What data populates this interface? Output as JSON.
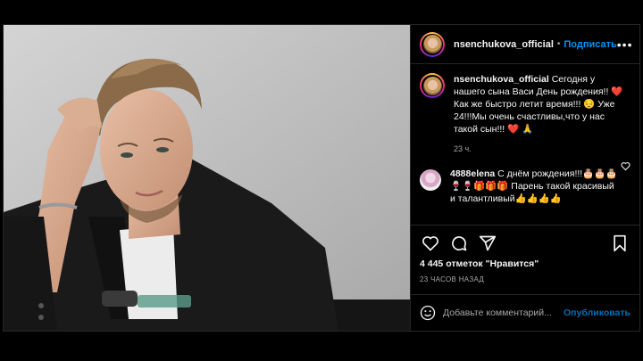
{
  "post": {
    "username": "nsenchukova_official",
    "follow_label": "Подписать",
    "more_label": "•••",
    "separator": "•"
  },
  "caption": {
    "username": "nsenchukova_official",
    "text": " Сегодня у нашего сына Васи День рождения!! ❤️ Как же быстро летит время!!! 😔 Уже 24!!!Мы очень счастливы,что у нас такой сын!!! ❤️ 🙏",
    "time": "23 ч."
  },
  "comment": {
    "username": "4888elena",
    "text": " С днём рождения!!!🎂🎂🎂🍷🍷🎁🎁🎁 Парень такой красивый и талантливый👍👍👍👍"
  },
  "stats": {
    "likes": "4 445 отметок \"Нравится\"",
    "time_ago": "23 ЧАСОВ НАЗАД"
  },
  "add_comment": {
    "placeholder": "Добавьте комментарий...",
    "publish_label": "Опубликовать"
  },
  "icons": {
    "like": "heart-icon",
    "comment": "comment-icon",
    "share": "share-icon",
    "save": "bookmark-icon",
    "emoji": "emoji-icon",
    "more": "more-icon"
  },
  "colors": {
    "background": "#000000",
    "link": "#0095f6",
    "muted": "#a8a8a8",
    "border": "#262626",
    "heart": "#ed4956"
  }
}
